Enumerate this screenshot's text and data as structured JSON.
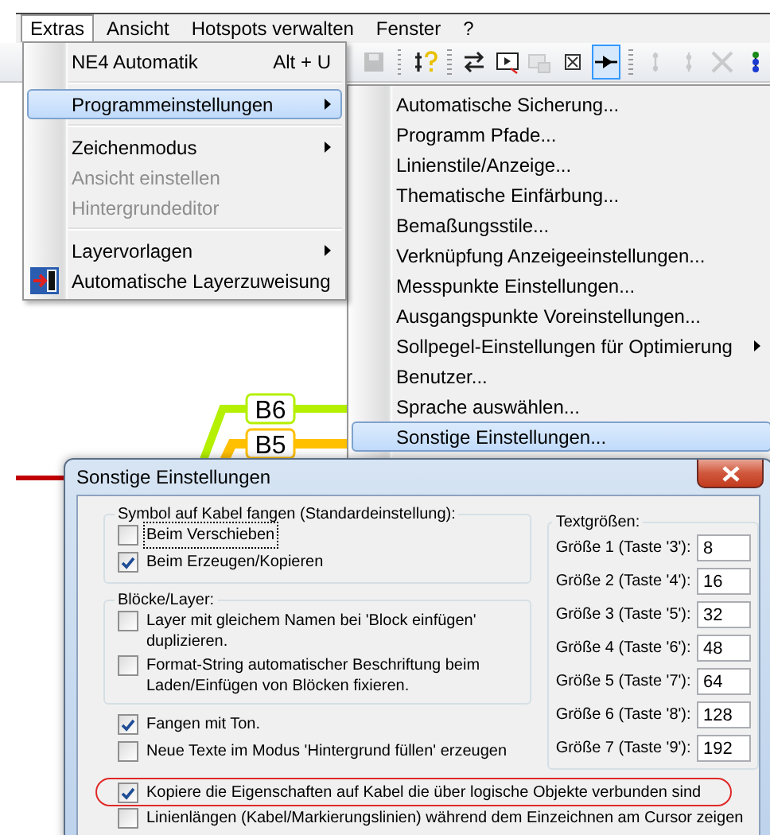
{
  "menubar": {
    "items": [
      {
        "label": "Extras",
        "selected": true
      },
      {
        "label": "Ansicht",
        "selected": false
      },
      {
        "label": "Hotspots verwalten",
        "selected": false
      },
      {
        "label": "Fenster",
        "selected": false
      },
      {
        "label": "?",
        "selected": false
      }
    ]
  },
  "toolbar": {
    "buttons": [
      {
        "kind": "button",
        "selected": false,
        "disabled": true
      },
      {
        "kind": "separator"
      },
      {
        "kind": "button",
        "selected": false,
        "disabled": false
      },
      {
        "kind": "separator"
      },
      {
        "kind": "button",
        "selected": false,
        "disabled": false
      },
      {
        "kind": "button",
        "selected": false,
        "disabled": false
      },
      {
        "kind": "button",
        "selected": false,
        "disabled": true
      },
      {
        "kind": "button",
        "selected": false,
        "disabled": false
      },
      {
        "kind": "button",
        "selected": true,
        "disabled": false
      },
      {
        "kind": "separator"
      },
      {
        "kind": "button",
        "selected": false,
        "disabled": true
      },
      {
        "kind": "button",
        "selected": false,
        "disabled": true
      },
      {
        "kind": "button",
        "selected": false,
        "disabled": true
      },
      {
        "kind": "button",
        "selected": false,
        "disabled": false
      }
    ]
  },
  "canvas": {
    "cables": [
      {
        "label": "B6",
        "color": "#b4f000"
      },
      {
        "label": "B5",
        "color": "#ffc000"
      }
    ]
  },
  "extras_menu": {
    "items": [
      {
        "kind": "item",
        "label": "NE4 Automatik",
        "shortcut": "Alt + U",
        "selected": false,
        "disabled": false,
        "submenu": false
      },
      {
        "kind": "separator"
      },
      {
        "kind": "item",
        "label": "Programmeinstellungen",
        "selected": true,
        "disabled": false,
        "submenu": true
      },
      {
        "kind": "separator"
      },
      {
        "kind": "item",
        "label": "Zeichenmodus",
        "selected": false,
        "disabled": false,
        "submenu": true
      },
      {
        "kind": "item",
        "label": "Ansicht einstellen",
        "selected": false,
        "disabled": true,
        "submenu": false
      },
      {
        "kind": "item",
        "label": "Hintergrundeditor",
        "selected": false,
        "disabled": true,
        "submenu": false
      },
      {
        "kind": "separator"
      },
      {
        "kind": "item",
        "label": "Layervorlagen",
        "selected": false,
        "disabled": false,
        "submenu": true
      },
      {
        "kind": "icon_item",
        "label": "Automatische Layerzuweisung",
        "selected": false,
        "disabled": false,
        "submenu": false
      }
    ]
  },
  "settings_menu": {
    "items": [
      {
        "kind": "item",
        "label": "Automatische Sicherung...",
        "selected": false,
        "submenu": false
      },
      {
        "kind": "item",
        "label": "Programm Pfade...",
        "selected": false,
        "submenu": false
      },
      {
        "kind": "item",
        "label": "Linienstile/Anzeige...",
        "selected": false,
        "submenu": false
      },
      {
        "kind": "item",
        "label": "Thematische Einfärbung...",
        "selected": false,
        "submenu": false
      },
      {
        "kind": "item",
        "label": "Bemaßungsstile...",
        "selected": false,
        "submenu": false
      },
      {
        "kind": "item",
        "label": "Verknüpfung Anzeigeeinstellungen...",
        "selected": false,
        "submenu": false
      },
      {
        "kind": "item",
        "label": "Messpunkte Einstellungen...",
        "selected": false,
        "submenu": false
      },
      {
        "kind": "item",
        "label": "Ausgangspunkte Voreinstellungen...",
        "selected": false,
        "submenu": false
      },
      {
        "kind": "item",
        "label": "Sollpegel-Einstellungen für Optimierung",
        "selected": false,
        "submenu": true
      },
      {
        "kind": "item",
        "label": "Benutzer...",
        "selected": false,
        "submenu": false
      },
      {
        "kind": "item",
        "label": "Sprache auswählen...",
        "selected": false,
        "submenu": false
      },
      {
        "kind": "item",
        "label": "Sonstige Einstellungen...",
        "selected": true,
        "submenu": false
      }
    ]
  },
  "dialog": {
    "title": "Sonstige Einstellungen",
    "groups": [
      {
        "title": "Symbol auf Kabel fangen (Standardeinstellung):",
        "options": [
          {
            "label": "Beim Verschieben",
            "checked": false,
            "focused": true,
            "highlighted": false
          },
          {
            "label": "Beim Erzeugen/Kopieren",
            "checked": true,
            "focused": false,
            "highlighted": false
          }
        ]
      },
      {
        "title": "Blöcke/Layer:",
        "options": [
          {
            "label": "Layer mit gleichem Namen bei 'Block einfügen' duplizieren.",
            "checked": false,
            "focused": false,
            "highlighted": false
          },
          {
            "label": "Format-String automatischer Beschriftung beim Laden/Einfügen von Blöcken fixieren.",
            "checked": false,
            "focused": false,
            "highlighted": false
          }
        ]
      }
    ],
    "options": [
      {
        "label": "Fangen mit Ton.",
        "checked": true,
        "focused": false,
        "highlighted": false
      },
      {
        "label": "Neue Texte im Modus 'Hintergrund füllen' erzeugen",
        "checked": false,
        "focused": false,
        "highlighted": false
      },
      {
        "label": "Kopiere die Eigenschaften auf Kabel die über logische Objekte verbunden sind",
        "checked": true,
        "focused": false,
        "highlighted": true
      },
      {
        "label": "Linienlängen (Kabel/Markierungslinien) während dem Einzeichnen am Cursor zeigen",
        "checked": false,
        "focused": false,
        "highlighted": false
      }
    ],
    "text_sizes": {
      "title": "Textgrößen:",
      "rows": [
        {
          "label": "Größe 1 (Taste '3'):",
          "value": "8"
        },
        {
          "label": "Größe 2 (Taste '4'):",
          "value": "16"
        },
        {
          "label": "Größe 3 (Taste '5'):",
          "value": "32"
        },
        {
          "label": "Größe 4 (Taste '6'):",
          "value": "48"
        },
        {
          "label": "Größe 5 (Taste '7'):",
          "value": "64"
        },
        {
          "label": "Größe 6 (Taste '8'):",
          "value": "128"
        },
        {
          "label": "Größe 7 (Taste '9'):",
          "value": "192"
        }
      ]
    }
  }
}
